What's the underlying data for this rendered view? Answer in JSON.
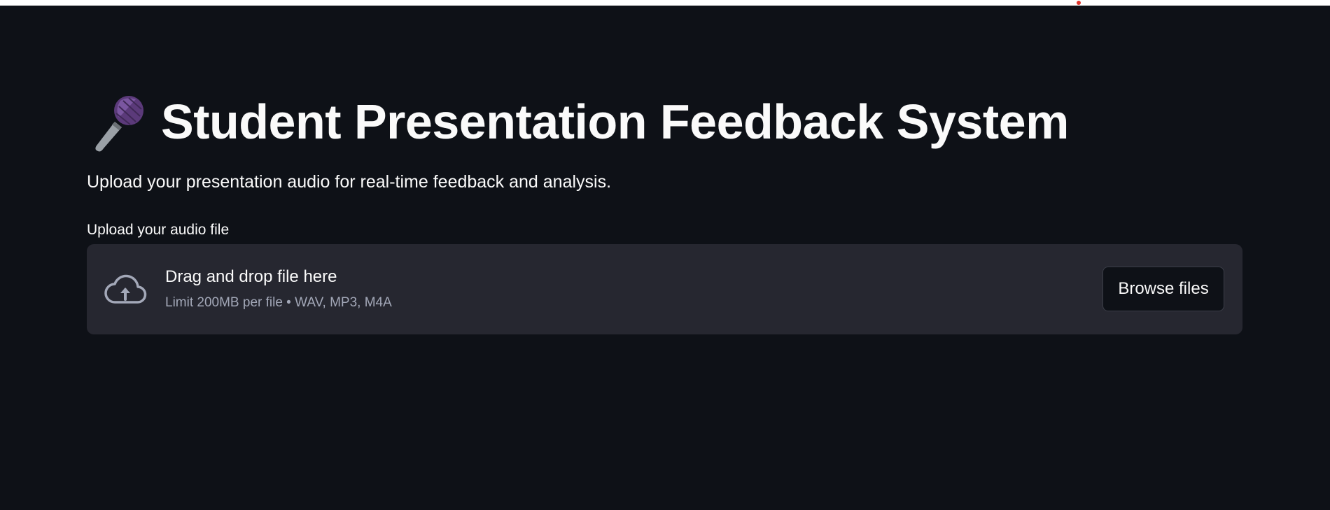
{
  "app": {
    "title_emoji_icon": "microphone-icon",
    "title": "Student Presentation Feedback System",
    "subtitle": "Upload your presentation audio for real-time feedback and analysis."
  },
  "uploader": {
    "label": "Upload your audio file",
    "icon": "cloud-upload-icon",
    "dropzone_title": "Drag and drop file here",
    "dropzone_limit": "Limit 200MB per file • WAV, MP3, M4A",
    "browse_label": "Browse files"
  },
  "colors": {
    "background": "#0e1117",
    "dropzone": "#262730",
    "text": "#fafafa",
    "muted_text": "#a3a8b8",
    "mic_head": "#5b3a7a"
  }
}
